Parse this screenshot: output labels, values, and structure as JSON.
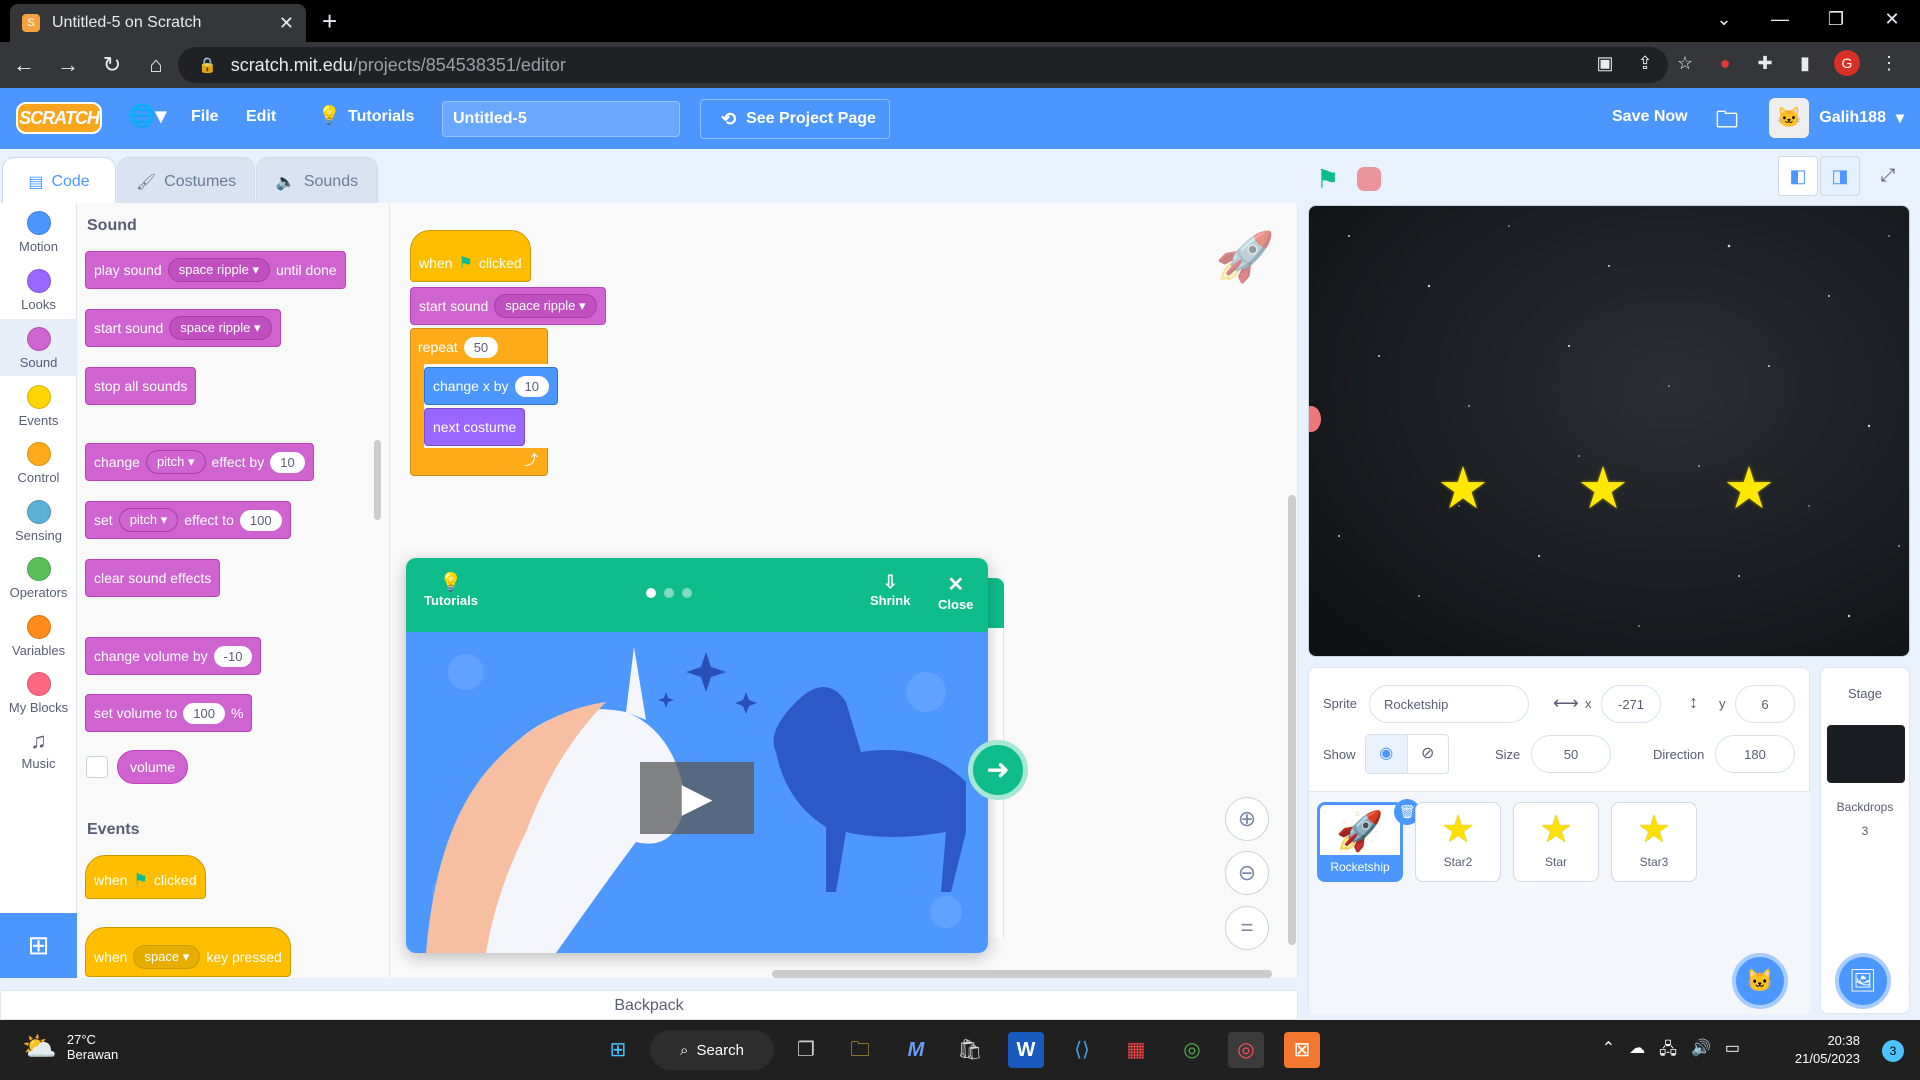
{
  "browser": {
    "tab_title": "Untitled-5 on Scratch",
    "url_host": "scratch.mit.edu",
    "url_path": "/projects/854538351/editor",
    "profile_initial": "G"
  },
  "menu": {
    "file": "File",
    "edit": "Edit",
    "tutorials": "Tutorials",
    "project_title": "Untitled-5",
    "see_project": "See Project Page",
    "save_now": "Save Now",
    "username": "Galih188",
    "logo_text": "SCRATCH"
  },
  "editor_tabs": {
    "code": "Code",
    "costumes": "Costumes",
    "sounds": "Sounds"
  },
  "categories": [
    {
      "label": "Motion",
      "color": "#4c97ff"
    },
    {
      "label": "Looks",
      "color": "#9966ff"
    },
    {
      "label": "Sound",
      "color": "#cf63cf"
    },
    {
      "label": "Events",
      "color": "#ffd500"
    },
    {
      "label": "Control",
      "color": "#ffab19"
    },
    {
      "label": "Sensing",
      "color": "#5cb1d6"
    },
    {
      "label": "Operators",
      "color": "#59c059"
    },
    {
      "label": "Variables",
      "color": "#ff8c1a"
    },
    {
      "label": "My Blocks",
      "color": "#ff6680"
    },
    {
      "label": "Music",
      "color": "#ffffff"
    }
  ],
  "palette": {
    "sound_header": "Sound",
    "events_header": "Events",
    "play_sound": "play sound",
    "until_done": "until done",
    "start_sound": "start sound",
    "sound_name": "space ripple",
    "stop_all": "stop all sounds",
    "change": "change",
    "set": "set",
    "pitch": "pitch",
    "effect_by": "effect by",
    "effect_to": "effect to",
    "change_val": "10",
    "set_val": "100",
    "clear_effects": "clear sound effects",
    "change_volume": "change volume by",
    "volume_change_val": "-10",
    "set_volume": "set volume to",
    "volume_set_val": "100",
    "percent": "%",
    "volume": "volume",
    "when": "when",
    "clicked": "clicked",
    "space": "space",
    "key_pressed": "key pressed"
  },
  "script": {
    "when": "when",
    "clicked": "clicked",
    "start_sound": "start sound",
    "sound_name": "space ripple",
    "repeat": "repeat",
    "repeat_val": "50",
    "change_x": "change x by",
    "change_x_val": "10",
    "next_costume": "next costume"
  },
  "tutorial": {
    "tutorials": "Tutorials",
    "shrink": "Shrink",
    "close": "Close"
  },
  "backpack": "Backpack",
  "sprite_info": {
    "sprite_label": "Sprite",
    "sprite_name": "Rocketship",
    "x_label": "x",
    "x_val": "-271",
    "y_label": "y",
    "y_val": "6",
    "show_label": "Show",
    "size_label": "Size",
    "size_val": "50",
    "direction_label": "Direction",
    "direction_val": "180"
  },
  "sprites": [
    "Rocketship",
    "Star2",
    "Star",
    "Star3"
  ],
  "stage_pane": {
    "title": "Stage",
    "backdrops_label": "Backdrops",
    "backdrops_count": "3"
  },
  "taskbar": {
    "temp": "27°C",
    "weather": "Berawan",
    "search": "Search",
    "time": "20:38",
    "date": "21/05/2023",
    "notifications": "3"
  }
}
